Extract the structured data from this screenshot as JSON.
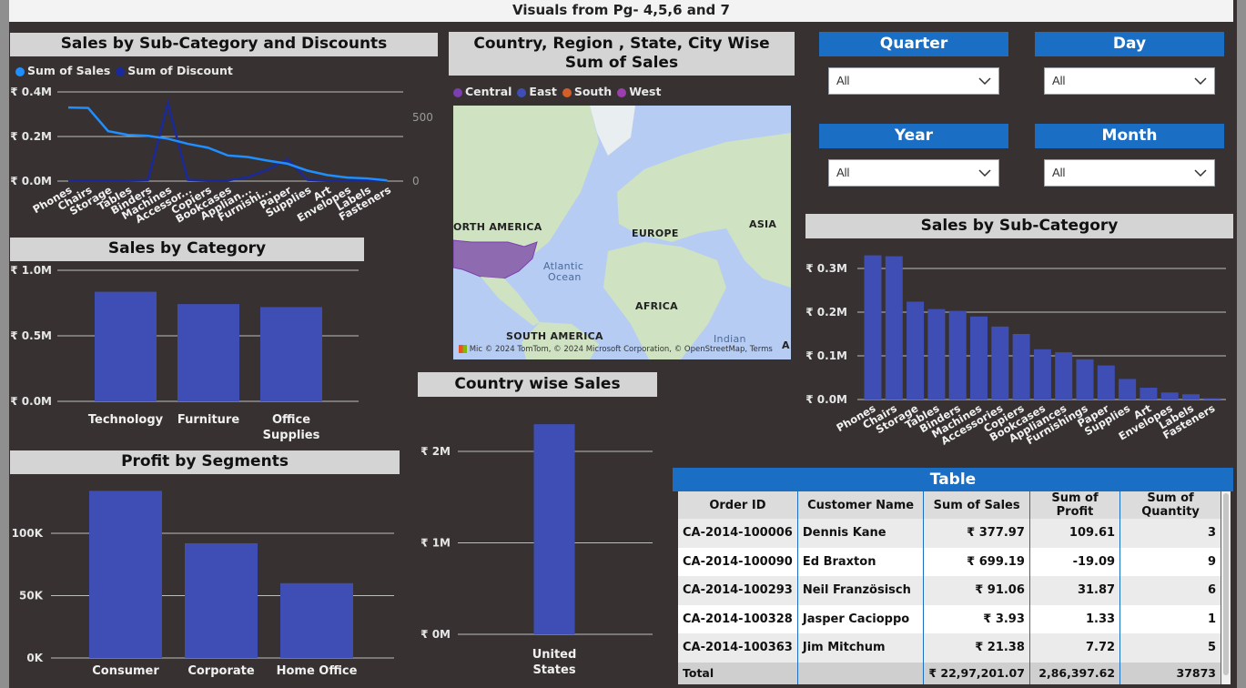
{
  "page_title": "Visuals from Pg- 4,5,6 and 7",
  "colors": {
    "bar": "#3f4eb5",
    "sales_line": "#1f8fff",
    "discount_line": "#1a2a9a",
    "title_bg": "#d4d4d4",
    "slicer_blue": "#1a6fc4"
  },
  "visual1": {
    "title": "Sales by Sub-Category and Discounts",
    "legend": [
      "Sum of Sales",
      "Sum of Discount"
    ],
    "y_left_ticks": [
      "₹ 0.4M",
      "₹ 0.2M",
      "₹ 0.0M"
    ],
    "y_right_ticks": [
      "500",
      "0"
    ]
  },
  "visual2": {
    "title": "Sales by Category",
    "y_ticks": [
      "₹ 1.0M",
      "₹ 0.5M",
      "₹ 0.0M"
    ]
  },
  "visual3": {
    "title": "Profit by Segments",
    "y_ticks": [
      "100K",
      "50K",
      "0K"
    ]
  },
  "visual4": {
    "title": "Country, Region , State, City Wise Sum of Sales",
    "legend": [
      "Central",
      "East",
      "South",
      "West"
    ],
    "legend_colors": [
      "#7b3fb0",
      "#3f4eb5",
      "#d35f28",
      "#9b3faf"
    ],
    "labels": [
      "ORTH AMERICA",
      "EUROPE",
      "ASIA",
      "Atlantic",
      "Ocean",
      "AFRICA",
      "SOUTH AMERICA",
      "Indian",
      "A"
    ],
    "attribution": "© 2024 TomTom, © 2024 Microsoft Corporation, © OpenStreetMap, Terms",
    "logo_text": "Mic"
  },
  "visual5": {
    "title": "Country wise Sales",
    "y_ticks": [
      "₹ 2M",
      "₹ 1M",
      "₹ 0M"
    ]
  },
  "visual6": {
    "title": "Sales by Sub-Category",
    "y_ticks": [
      "₹ 0.3M",
      "₹ 0.2M",
      "₹ 0.1M",
      "₹ 0.0M"
    ]
  },
  "slicers": [
    {
      "label": "Quarter",
      "value": "All"
    },
    {
      "label": "Day",
      "value": "All"
    },
    {
      "label": "Year",
      "value": "All"
    },
    {
      "label": "Month",
      "value": "All"
    }
  ],
  "table": {
    "title": "Table",
    "headers": [
      "Order ID",
      "Customer Name",
      "Sum of Sales",
      "Sum of Profit",
      "Sum of Quantity"
    ],
    "rows": [
      [
        "CA-2014-100006",
        "Dennis Kane",
        "₹ 377.97",
        "109.61",
        "3"
      ],
      [
        "CA-2014-100090",
        "Ed Braxton",
        "₹ 699.19",
        "-19.09",
        "9"
      ],
      [
        "CA-2014-100293",
        "Neil Französisch",
        "₹ 91.06",
        "31.87",
        "6"
      ],
      [
        "CA-2014-100328",
        "Jasper Cacioppo",
        "₹ 3.93",
        "1.33",
        "1"
      ],
      [
        "CA-2014-100363",
        "Jim Mitchum",
        "₹ 21.38",
        "7.72",
        "5"
      ]
    ],
    "total": [
      "Total",
      "",
      "₹ 22,97,201.07",
      "2,86,397.62",
      "37873"
    ]
  },
  "chart_data": [
    {
      "type": "line",
      "title": "Sales by Sub-Category and Discounts",
      "categories": [
        "Phones",
        "Chairs",
        "Storage",
        "Tables",
        "Binders",
        "Machines",
        "Accessor...",
        "Copiers",
        "Bookcases",
        "Applian...",
        "Furnishi...",
        "Paper",
        "Supplies",
        "Art",
        "Envelopes",
        "Labels",
        "Fasteners"
      ],
      "series": [
        {
          "name": "Sum of Sales",
          "axis": "left",
          "values": [
            330000,
            328000,
            224000,
            207000,
            203000,
            190000,
            167000,
            150000,
            115000,
            108000,
            92000,
            78000,
            47000,
            27000,
            16000,
            12000,
            3000
          ]
        },
        {
          "name": "Sum of Discount",
          "axis": "right",
          "values": [
            5,
            5,
            5,
            5,
            8,
            610,
            10,
            5,
            5,
            30,
            90,
            170,
            10,
            5,
            5,
            5,
            5
          ]
        }
      ],
      "ylim_left": [
        0,
        400000
      ],
      "ylim_right": [
        0,
        700
      ]
    },
    {
      "type": "bar",
      "title": "Sales by Category",
      "categories": [
        "Technology",
        "Furniture",
        "Office Supplies"
      ],
      "values": [
        836000,
        742000,
        719000
      ],
      "ylim": [
        0,
        1000000
      ]
    },
    {
      "type": "bar",
      "title": "Profit by Segments",
      "categories": [
        "Consumer",
        "Corporate",
        "Home Office"
      ],
      "values": [
        134000,
        92000,
        60000
      ],
      "ylim": [
        0,
        100000
      ]
    },
    {
      "type": "bar",
      "title": "Country wise Sales",
      "categories": [
        "United States"
      ],
      "values": [
        2297000
      ],
      "ylim": [
        0,
        2000000
      ]
    },
    {
      "type": "bar",
      "title": "Sales by Sub-Category",
      "categories": [
        "Phones",
        "Chairs",
        "Storage",
        "Tables",
        "Binders",
        "Machines",
        "Accessories",
        "Copiers",
        "Bookcases",
        "Appliances",
        "Furnishings",
        "Paper",
        "Supplies",
        "Art",
        "Envelopes",
        "Labels",
        "Fasteners"
      ],
      "values": [
        330000,
        328000,
        224000,
        207000,
        203000,
        190000,
        167000,
        150000,
        115000,
        108000,
        92000,
        78000,
        47000,
        27000,
        16000,
        12000,
        3000
      ],
      "ylim": [
        0,
        300000
      ]
    }
  ]
}
